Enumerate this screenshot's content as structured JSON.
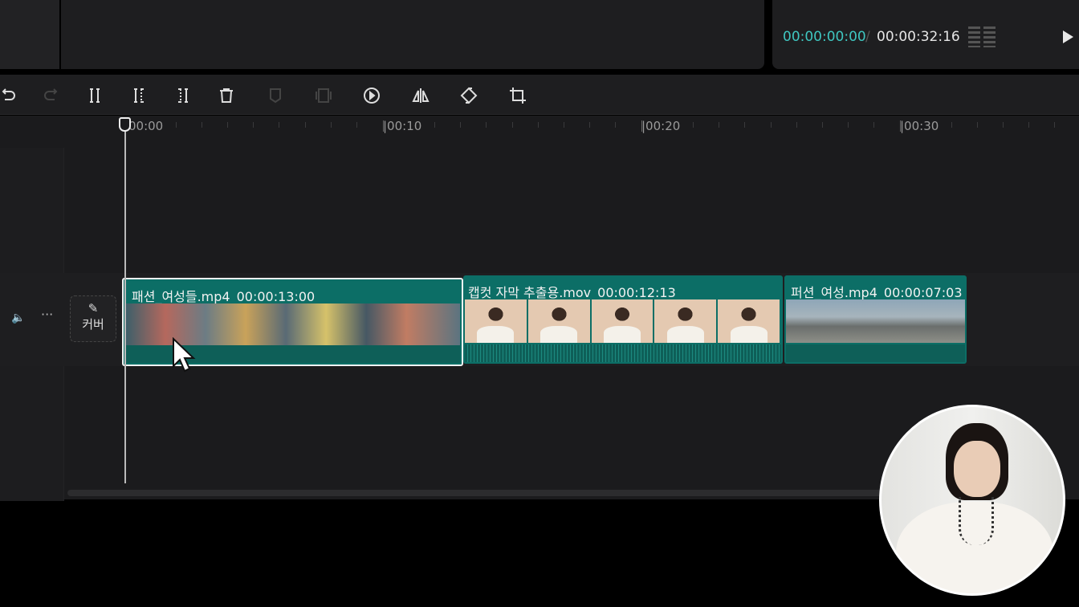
{
  "preview": {
    "current_time": "00:00:00:00",
    "separator": "/",
    "total_time": "00:00:32:16"
  },
  "toolbar": {
    "buttons": [
      "undo",
      "redo",
      "split",
      "split-left",
      "split-right",
      "delete",
      "mark",
      "freeze-frame",
      "reverse",
      "mirror",
      "rotate",
      "crop"
    ]
  },
  "ruler": {
    "labels": [
      "00:00",
      "|00:10",
      "|00:20",
      "|00:30"
    ]
  },
  "track": {
    "cover_label": "커버",
    "clips": [
      {
        "name": "패션_여성들.mp4",
        "duration": "00:00:13:00",
        "selected": true
      },
      {
        "name": "캡컷 자막 추출용.mov",
        "duration": "00:00:12:13",
        "selected": false
      },
      {
        "name": "퍼션_여성.mp4",
        "duration": "00:00:07:03",
        "selected": false
      }
    ]
  },
  "colors": {
    "accent": "#3fc6c0",
    "clip": "#0c6e66",
    "background": "#1b1b1d"
  }
}
